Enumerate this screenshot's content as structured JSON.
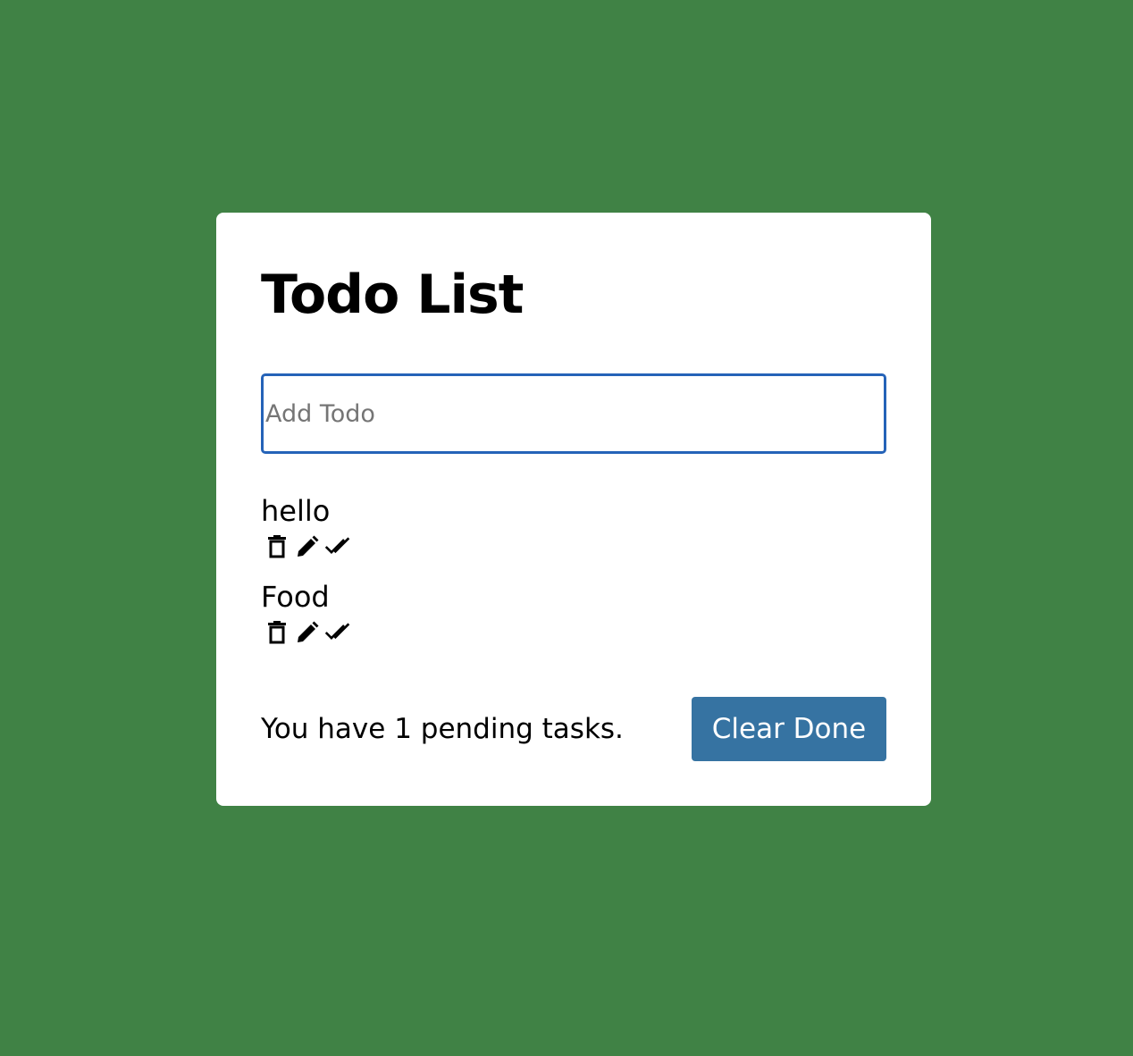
{
  "colors": {
    "background": "#408245",
    "card": "#ffffff",
    "input_border": "#2563b8",
    "button": "#3673a2"
  },
  "app": {
    "title": "Todo List"
  },
  "input": {
    "placeholder": "Add Todo",
    "value": ""
  },
  "todos": [
    {
      "text": "hello",
      "actions": [
        "trash-icon",
        "pencil-icon",
        "double-check-icon"
      ]
    },
    {
      "text": "Food",
      "actions": [
        "trash-icon",
        "pencil-icon",
        "double-check-icon"
      ]
    }
  ],
  "footer": {
    "pending_text": "You have 1 pending tasks.",
    "clear_label": "Clear Done"
  }
}
